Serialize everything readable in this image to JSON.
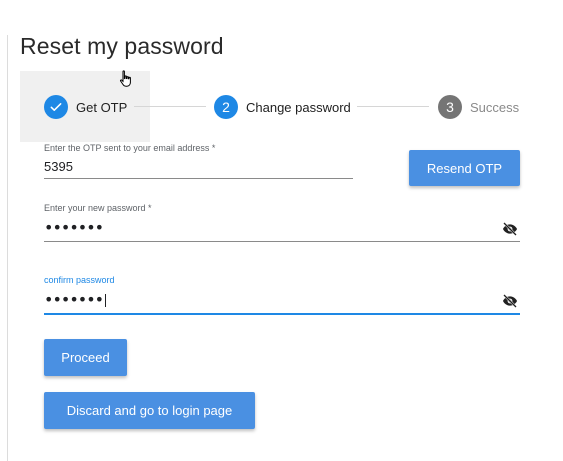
{
  "title": "Reset my password",
  "stepper": {
    "steps": [
      {
        "label": "Get OTP",
        "state": "completed",
        "icon": "check-icon"
      },
      {
        "number": "2",
        "label": "Change password",
        "state": "active"
      },
      {
        "number": "3",
        "label": "Success",
        "state": "inactive"
      }
    ]
  },
  "otp_field": {
    "label": "Enter the OTP sent to your email address *",
    "value": "5395"
  },
  "resend_button": "Resend OTP",
  "new_password_field": {
    "label": "Enter your new password *",
    "masked_value": "•••••••",
    "icon": "eye-off-icon"
  },
  "confirm_password_field": {
    "label": "confirm password",
    "masked_value": "•••••••",
    "icon": "eye-off-icon"
  },
  "proceed_button": "Proceed",
  "discard_button": "Discard and go to login page",
  "colors": {
    "accent": "#1e88e5",
    "button": "#4a90e2",
    "inactive_step": "#757575"
  }
}
